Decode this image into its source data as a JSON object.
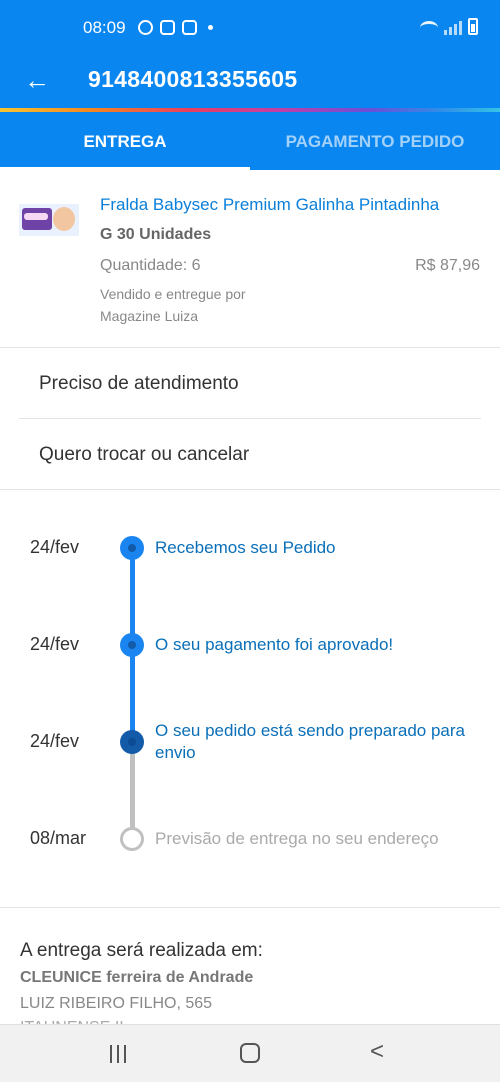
{
  "status_bar": {
    "time": "08:09"
  },
  "header": {
    "back_icon": "←",
    "order_number": "9148400813355605"
  },
  "tabs": [
    {
      "label": "ENTREGA",
      "active": true
    },
    {
      "label": "PAGAMENTO PEDIDO",
      "active": false
    }
  ],
  "product": {
    "name": "Fralda Babysec Premium Galinha Pintadinha",
    "variant": "G 30 Unidades",
    "quantity": "Quantidade: 6",
    "price": "R$ 87,96",
    "seller_label": "Vendido e entregue por",
    "seller": "Magazine Luiza"
  },
  "menu": [
    {
      "label": "Preciso de atendimento"
    },
    {
      "label": "Quero trocar ou cancelar"
    }
  ],
  "timeline": [
    {
      "date": "24/fev",
      "text": "Recebemos seu Pedido",
      "status": "done"
    },
    {
      "date": "24/fev",
      "text": "O seu pagamento foi aprovado!",
      "status": "done"
    },
    {
      "date": "24/fev",
      "text": "O seu pedido está sendo preparado para envio",
      "status": "current"
    },
    {
      "date": "08/mar",
      "text": "Previsão de entrega no seu endereço",
      "status": "pending"
    }
  ],
  "delivery": {
    "title": "A entrega será realizada em:",
    "recipient": "CLEUNICE ferreira de Andrade",
    "address": "LUIZ RIBEIRO FILHO, 565",
    "address_line2": "ITAUNENSE II"
  },
  "colors": {
    "primary": "#0a86f0",
    "timeline_done": "#1a85f0",
    "timeline_pending": "#c0c0c0",
    "link_text": "#0a7fd9"
  },
  "icons": {
    "back": "arrow-left-icon",
    "nav_recent": "recent-apps-icon",
    "nav_home": "home-icon",
    "nav_back": "chevron-left-icon"
  }
}
